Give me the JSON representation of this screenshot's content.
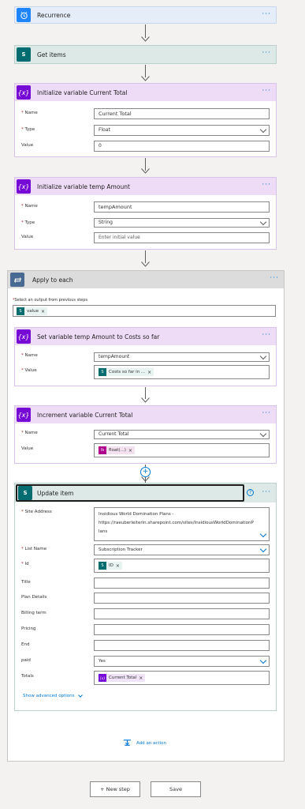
{
  "colors": {
    "blue_header": "#e5edf9",
    "sharepoint_header": "#dce9e7",
    "variable_header": "#eedcf6",
    "loop_header": "#dcdcdc",
    "variable_icon": "#770bd6",
    "sharepoint_icon": "#036c70",
    "recurrence_icon": "#1f85ff",
    "loop_icon": "#486991",
    "accent": "#0078d4"
  },
  "steps": {
    "recurrence": {
      "title": "Recurrence",
      "icon": "alarm-clock-icon"
    },
    "get_items": {
      "title": "Get items",
      "icon": "sharepoint-icon"
    },
    "init_current_total": {
      "title": "Initialize variable Current Total",
      "name_label": "Name",
      "name_value": "Current Total",
      "type_label": "Type",
      "type_value": "Float",
      "value_label": "Value",
      "value_value": "0"
    },
    "init_temp_amount": {
      "title": "Initialize variable temp Amount",
      "name_label": "Name",
      "name_value": "tempAmount",
      "type_label": "Type",
      "type_value": "String",
      "value_label": "Value",
      "value_placeholder": "Enter initial value"
    },
    "apply_to_each": {
      "title": "Apply to each",
      "select_label": "Select an output from previous steps",
      "token": "value"
    },
    "set_temp_amount": {
      "title": "Set variable temp Amount to Costs so far",
      "name_label": "Name",
      "name_value": "tempAmount",
      "value_label": "Value",
      "value_token": "Costs so far in ..."
    },
    "increment_total": {
      "title": "Increment variable Current Total",
      "name_label": "Name",
      "name_value": "Current Total",
      "value_label": "Value",
      "value_token": "float(...)"
    },
    "update_item": {
      "title": "Update item",
      "site_label": "Site Address",
      "site_value_1": "Insidious World Domination Plans -",
      "site_value_2": "https://raeuberleiterin.sharepoint.com/sites/InsidiousWorldDominationP",
      "site_value_3": "lans",
      "list_label": "List Name",
      "list_value": "Subscription Tracker",
      "id_label": "Id",
      "id_token": "ID",
      "title_label": "Title",
      "plan_label": "Plan Details",
      "billing_label": "Billing term",
      "pricing_label": "Pricing",
      "end_label": "End",
      "paid_label": "paid",
      "paid_value": "Yes",
      "totals_label": "Totals",
      "totals_token": "Current Total",
      "advanced": "Show advanced options"
    }
  },
  "add_action": "Add an action",
  "new_step": "+ New step",
  "save": "Save"
}
